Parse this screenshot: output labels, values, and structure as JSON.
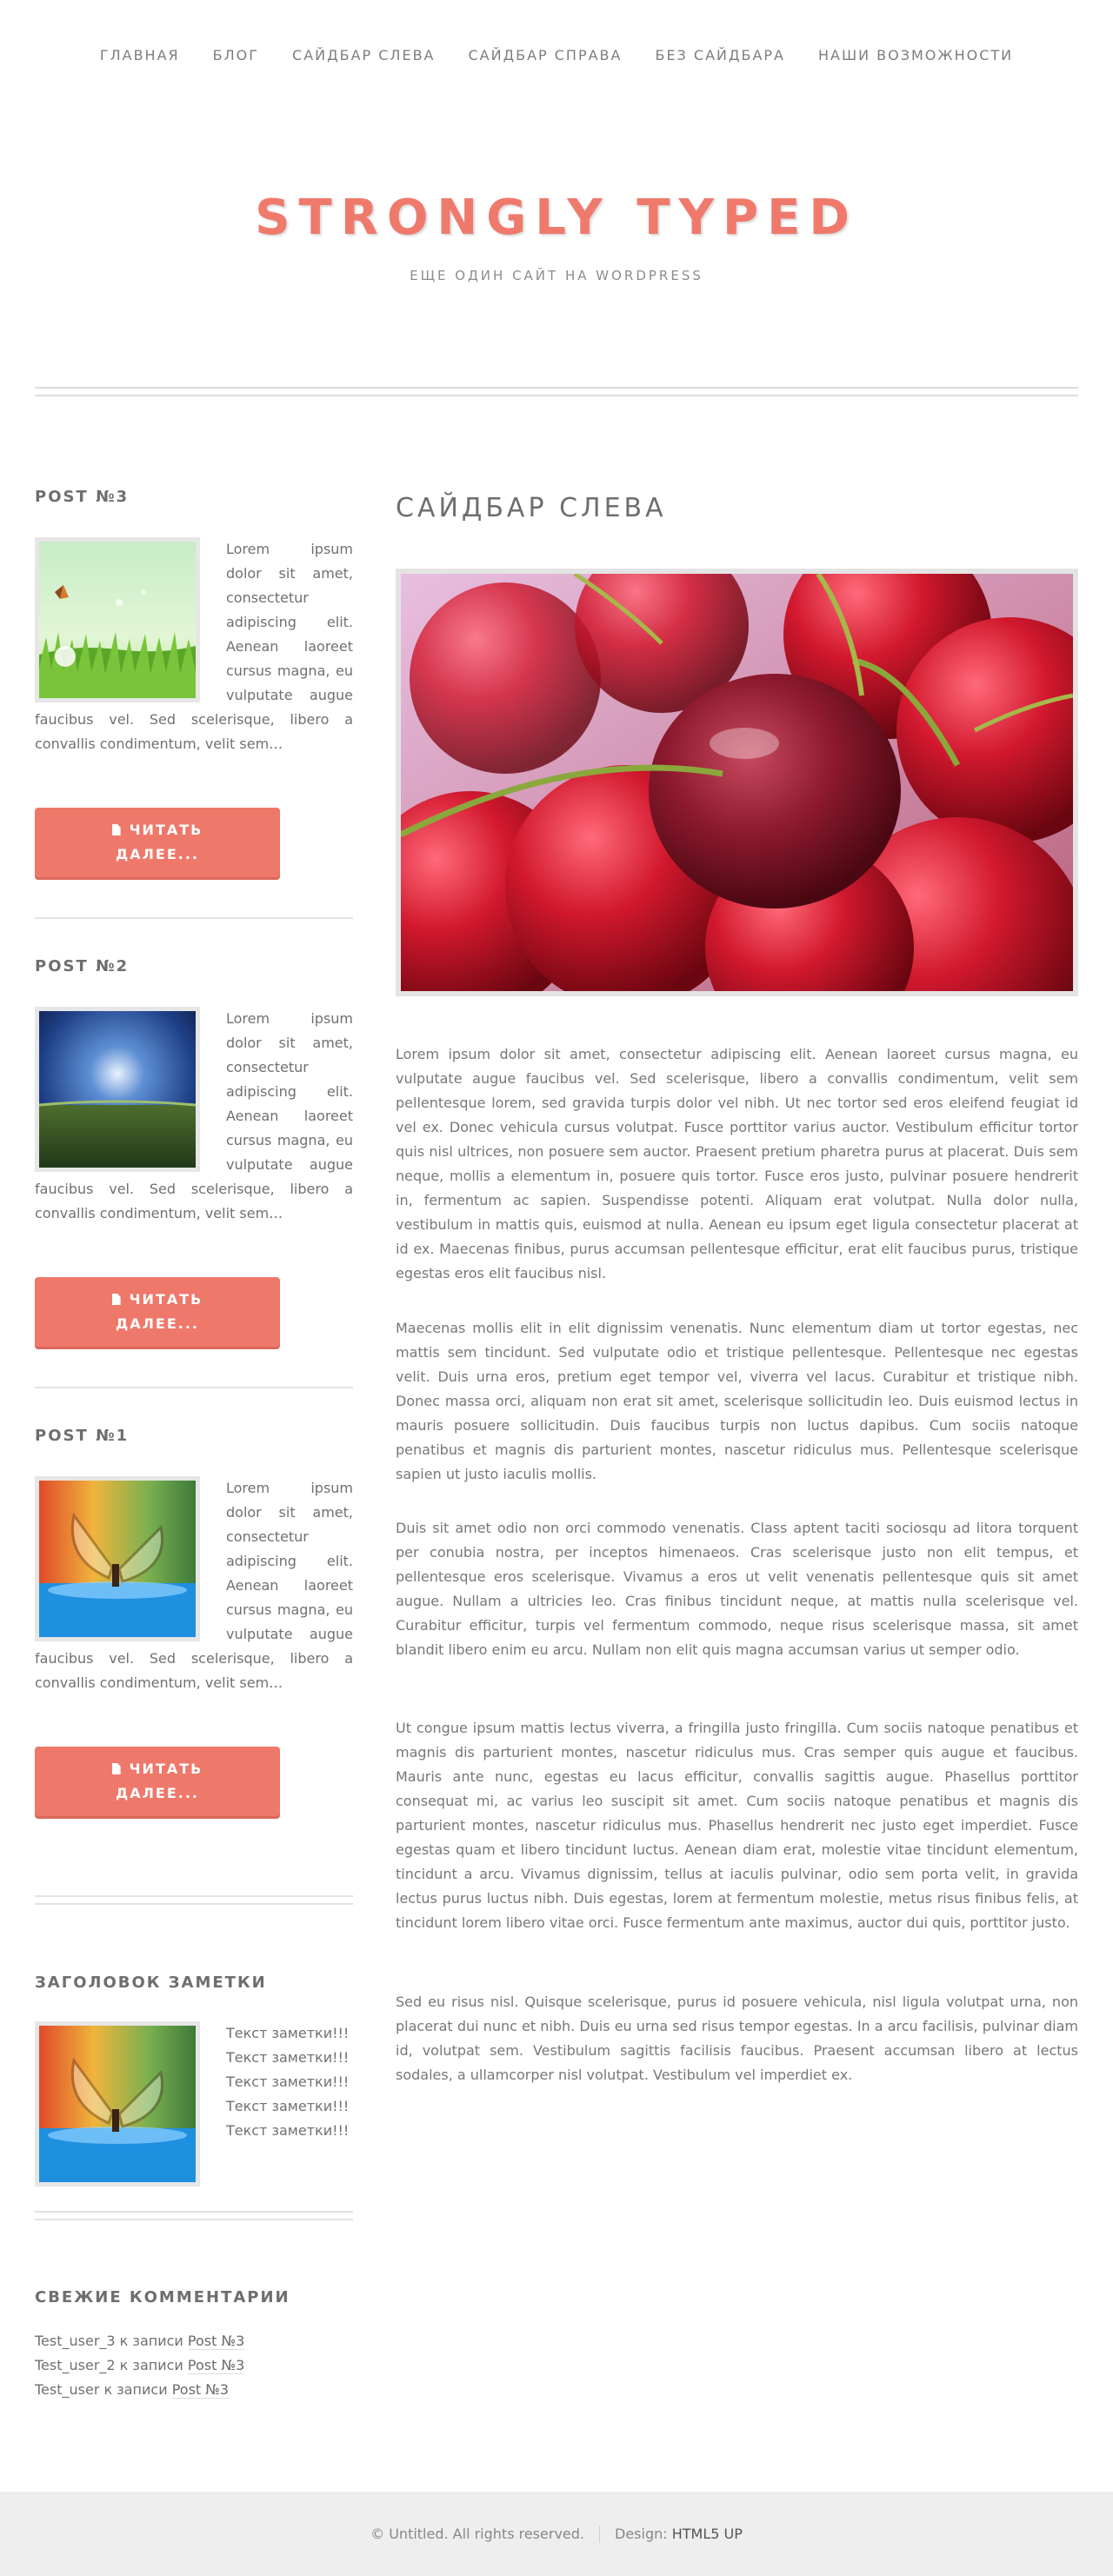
{
  "nav": {
    "items": [
      "Главная",
      "Блог",
      "Сайдбар слева",
      "Сайдбар справа",
      "Без сайдбара",
      "Наши возможности"
    ]
  },
  "site": {
    "title": "STRONGLY TYPED",
    "tagline": "Еще один сайт на WordPress"
  },
  "sidebar": {
    "posts": [
      {
        "title": "POST №3",
        "excerpt": "Lorem ipsum dolor sit amet, consectetur adipiscing elit. Aenean laoreet cursus magna, eu vulputate augue faucibus vel. Sed scelerisque, libero a convallis condimentum, velit sem…",
        "button": "Читать далее...",
        "image": "grass-butterfly"
      },
      {
        "title": "POST №2",
        "excerpt": "Lorem ipsum dolor sit amet, consectetur adipiscing elit. Aenean laoreet cursus magna, eu vulputate augue faucibus vel. Sed scelerisque, libero a convallis condimentum, velit sem…",
        "button": "Читать далее...",
        "image": "storm-field"
      },
      {
        "title": "POST №1",
        "excerpt": "Lorem ipsum dolor sit amet, consectetur adipiscing elit. Aenean laoreet cursus magna, eu vulputate augue faucibus vel. Sed scelerisque, libero a convallis condimentum, velit sem…",
        "button": "Читать далее...",
        "image": "glasswing-butterfly"
      }
    ],
    "note": {
      "title": "ЗАГОЛОВОК ЗАМЕТКИ",
      "lines": [
        "Текст заметки!!!",
        "Текст заметки!!!",
        "Текст заметки!!!",
        "Текст заметки!!!",
        "Текст заметки!!!"
      ],
      "image": "glasswing-butterfly"
    },
    "comments": {
      "title": "СВЕЖИЕ КОММЕНТАРИИ",
      "items": [
        {
          "author": "Test_user_3",
          "middle": " к записи ",
          "post": "Post №3"
        },
        {
          "author": "Test_user_2",
          "middle": " к записи ",
          "post": "Post №3"
        },
        {
          "author": "Test_user",
          "middle": " к записи ",
          "post": "Post №3"
        }
      ]
    }
  },
  "main": {
    "title": "Сайдбар слева",
    "hero_image": "cherries",
    "paragraphs": [
      "Lorem ipsum dolor sit amet, consectetur adipiscing elit. Aenean laoreet cursus magna, eu vulputate augue faucibus vel. Sed scelerisque, libero a convallis condimentum, velit sem pellentesque lorem, sed gravida turpis dolor vel nibh. Ut nec tortor sed eros eleifend feugiat id vel ex. Donec vehicula cursus volutpat. Fusce porttitor varius auctor. Vestibulum efficitur tortor quis nisl ultrices, non posuere sem auctor. Praesent pretium pharetra purus at placerat. Duis sem neque, mollis a elementum in, posuere quis tortor. Fusce eros justo, pulvinar posuere hendrerit in, fermentum ac sapien. Suspendisse potenti. Aliquam erat volutpat. Nulla dolor nulla, vestibulum in mattis quis, euismod at nulla. Aenean eu ipsum eget ligula consectetur placerat at id ex. Maecenas finibus, purus accumsan pellentesque efficitur, erat elit faucibus purus, tristique egestas eros elit faucibus nisl.",
      "Maecenas mollis elit in elit dignissim venenatis. Nunc elementum diam ut tortor egestas, nec mattis sem tincidunt. Sed vulputate odio et tristique pellentesque. Pellentesque nec egestas velit. Duis urna eros, pretium eget tempor vel, viverra vel lacus. Curabitur et tristique nibh. Donec massa orci, aliquam non erat sit amet, scelerisque sollicitudin leo. Duis euismod lectus in mauris posuere sollicitudin. Duis faucibus turpis non luctus dapibus. Cum sociis natoque penatibus et magnis dis parturient montes, nascetur ridiculus mus. Pellentesque scelerisque sapien ut justo iaculis mollis.",
      "Duis sit amet odio non orci commodo venenatis. Class aptent taciti sociosqu ad litora torquent per conubia nostra, per inceptos himenaeos. Cras scelerisque justo non elit tempus, et pellentesque eros scelerisque. Vivamus a eros ut velit venenatis pellentesque quis sit amet augue. Nullam a ultricies leo. Cras finibus tincidunt neque, at mattis nulla scelerisque vel. Curabitur efficitur, turpis vel fermentum commodo, neque risus scelerisque massa, sit amet blandit libero enim eu arcu. Nullam non elit quis magna accumsan varius ut semper odio.",
      "Ut congue ipsum mattis lectus viverra, a fringilla justo fringilla. Cum sociis natoque penatibus et magnis dis parturient montes, nascetur ridiculus mus. Cras semper quis augue et faucibus. Mauris ante nunc, egestas eu lacus efficitur, convallis sagittis augue. Phasellus porttitor consequat mi, ac varius leo suscipit sit amet. Cum sociis natoque penatibus et magnis dis parturient montes, nascetur ridiculus mus. Phasellus hendrerit nec justo eget imperdiet. Fusce egestas quam et libero tincidunt luctus. Aenean diam erat, molestie vitae tincidunt elementum, tincidunt a arcu. Vivamus dignissim, tellus at iaculis pulvinar, odio sem porta velit, in gravida lectus purus luctus nibh. Duis egestas, lorem at fermentum molestie, metus risus finibus felis, at tincidunt lorem libero vitae orci. Fusce fermentum ante maximus, auctor dui quis, porttitor justo.",
      "Sed eu risus nisl. Quisque scelerisque, purus id posuere vehicula, nisl ligula volutpat urna, non placerat dui nunc et nibh. Duis eu urna sed risus tempor egestas. In a arcu facilisis, pulvinar diam id, volutpat sem. Vestibulum sagittis facilisis faucibus. Praesent accumsan libero at lectus sodales, a ullamcorper nisl volutpat. Vestibulum vel imperdiet ex."
    ]
  },
  "footer": {
    "copyright": "© Untitled. All rights reserved.",
    "design_label": "Design: ",
    "design_link": "HTML5 UP"
  },
  "colors": {
    "accent": "#ee786a",
    "text": "#777777",
    "footer_bg": "#eeeeee"
  }
}
